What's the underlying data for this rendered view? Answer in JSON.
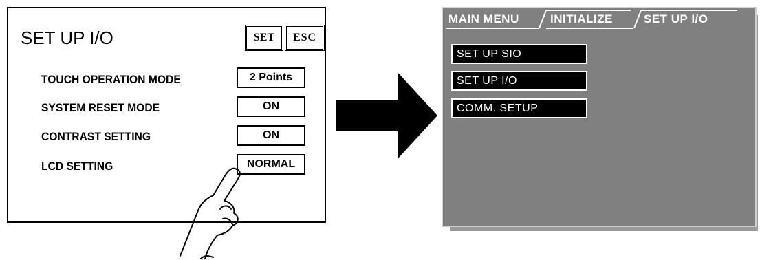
{
  "left_screen": {
    "title": "SET UP I/O",
    "set_label": "SET",
    "esc_label": "ESC",
    "settings": [
      {
        "label": "TOUCH OPERATION MODE",
        "value": "2 Points"
      },
      {
        "label": "SYSTEM RESET MODE",
        "value": "ON"
      },
      {
        "label": "CONTRAST SETTING",
        "value": "ON"
      },
      {
        "label": "LCD SETTING",
        "value": "NORMAL"
      }
    ]
  },
  "right_screen": {
    "breadcrumb": [
      "MAIN MENU",
      "INITIALIZE",
      "SET UP I/O"
    ],
    "menu_items": [
      "SET UP SIO",
      "SET UP I/O",
      "COMM. SETUP"
    ],
    "colors": {
      "background": "#808080",
      "item_background": "#000000",
      "text": "#ffffff"
    }
  },
  "icons": [
    "pointing-hand-icon",
    "right-arrow-icon"
  ]
}
